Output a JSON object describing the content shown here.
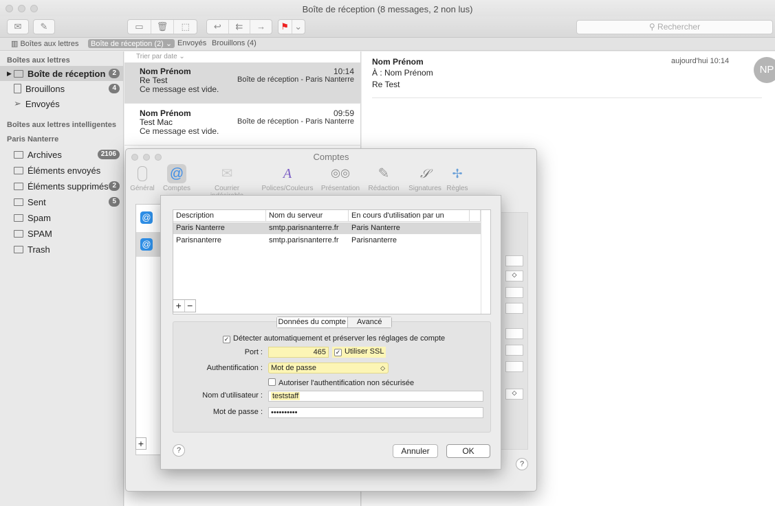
{
  "window": {
    "title": "Boîte de réception (8 messages, 2 non lus)"
  },
  "toolbar": {
    "search_placeholder": "Rechercher"
  },
  "favorites": {
    "mailboxes": "Boîtes aux lettres",
    "inbox": "Boîte de réception (2)",
    "sent": "Envoyés",
    "drafts": "Brouillons (4)"
  },
  "sidebar": {
    "header_mailboxes": "Boîtes aux lettres",
    "header_smart": "Boîtes aux lettres intelligentes",
    "header_account": "Paris Nanterre",
    "items": [
      {
        "label": "Boîte de réception",
        "badge": "2"
      },
      {
        "label": "Brouillons",
        "badge": "4"
      },
      {
        "label": "Envoyés",
        "badge": ""
      }
    ],
    "account_items": [
      {
        "label": "Archives",
        "badge": "2106"
      },
      {
        "label": "Éléments envoyés",
        "badge": ""
      },
      {
        "label": "Éléments supprimés",
        "badge": "2"
      },
      {
        "label": "Sent",
        "badge": "5"
      },
      {
        "label": "Spam",
        "badge": ""
      },
      {
        "label": "SPAM",
        "badge": ""
      },
      {
        "label": "Trash",
        "badge": ""
      }
    ]
  },
  "messages": {
    "sort_label": "Trier par date ⌄",
    "list": [
      {
        "from": "Nom Prénom",
        "time": "10:14",
        "subject": "Re Test",
        "mailbox": "Boîte de réception - Paris Nanterre",
        "body": "Ce message est vide."
      },
      {
        "from": "Nom Prénom",
        "time": "09:59",
        "subject": "Test Mac",
        "mailbox": "Boîte de réception - Paris Nanterre",
        "body": "Ce message est vide."
      }
    ]
  },
  "reader": {
    "from": "Nom Prénom",
    "to_label": "À :",
    "to": "Nom Prénom",
    "subject": "Re Test",
    "date": "aujourd'hui 10:14",
    "avatar": "NP"
  },
  "prefs": {
    "title": "Comptes",
    "tabs": [
      "Général",
      "Comptes",
      "Courrier indésirable",
      "Polices/Couleurs",
      "Présentation",
      "Rédaction",
      "Signatures",
      "Règles"
    ]
  },
  "sheet": {
    "columns": [
      "Description",
      "Nom du serveur",
      "En cours d'utilisation par un compte"
    ],
    "rows": [
      {
        "desc": "Paris Nanterre",
        "server": "smtp.parisnanterre.fr",
        "used": "Paris Nanterre"
      },
      {
        "desc": "Parisnanterre",
        "server": "smtp.parisnanterre.fr",
        "used": "Parisnanterre"
      }
    ],
    "tab_account": "Données du compte",
    "tab_advanced": "Avancé",
    "auto_detect": "Détecter automatiquement et préserver les réglages de compte",
    "port_label": "Port :",
    "port_value": "465",
    "ssl_label": "Utiliser SSL",
    "auth_label": "Authentification :",
    "auth_value": "Mot de passe",
    "insecure_label": "Autoriser l'authentification non sécurisée",
    "user_label": "Nom d'utilisateur :",
    "user_value": "teststaff",
    "pass_label": "Mot de passe :",
    "pass_value": "••••••••••",
    "cancel": "Annuler",
    "ok": "OK"
  }
}
